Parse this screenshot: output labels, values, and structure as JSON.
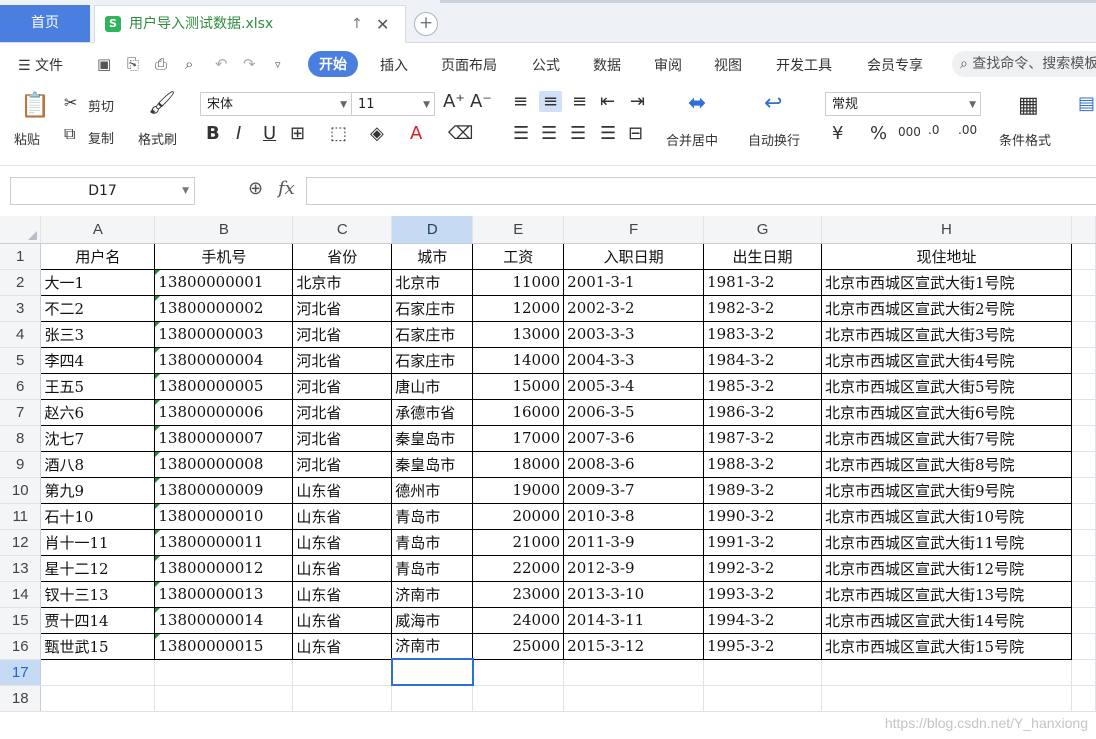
{
  "tabs": {
    "home": "首页",
    "file_name": "用户导入测试数据.xlsx"
  },
  "menu": {
    "file": "文件",
    "tabs": [
      "开始",
      "插入",
      "页面布局",
      "公式",
      "数据",
      "审阅",
      "视图",
      "开发工具",
      "会员专享"
    ],
    "search_placeholder": "查找命令、搜索模板"
  },
  "ribbon": {
    "paste": "粘贴",
    "cut": "剪切",
    "copy": "复制",
    "format_painter": "格式刷",
    "font_name": "宋体",
    "font_size": "11",
    "merge_center": "合并居中",
    "wrap_text": "自动换行",
    "number_format": "常规",
    "conditional_format": "条件格式"
  },
  "formula_bar": {
    "cell_ref": "D17",
    "fx": "fx",
    "value": ""
  },
  "sheet": {
    "columns": [
      "A",
      "B",
      "C",
      "D",
      "E",
      "F",
      "G",
      "H"
    ],
    "headers": [
      "用户名",
      "手机号",
      "省份",
      "城市",
      "工资",
      "入职日期",
      "出生日期",
      "现住地址"
    ],
    "rows": [
      [
        "大一1",
        "13800000001",
        "北京市",
        "北京市",
        "11000",
        "2001-3-1",
        "1981-3-2",
        "北京市西城区宣武大街1号院"
      ],
      [
        "不二2",
        "13800000002",
        "河北省",
        "石家庄市",
        "12000",
        "2002-3-2",
        "1982-3-2",
        "北京市西城区宣武大街2号院"
      ],
      [
        "张三3",
        "13800000003",
        "河北省",
        "石家庄市",
        "13000",
        "2003-3-3",
        "1983-3-2",
        "北京市西城区宣武大街3号院"
      ],
      [
        "李四4",
        "13800000004",
        "河北省",
        "石家庄市",
        "14000",
        "2004-3-3",
        "1984-3-2",
        "北京市西城区宣武大街4号院"
      ],
      [
        "王五5",
        "13800000005",
        "河北省",
        "唐山市",
        "15000",
        "2005-3-4",
        "1985-3-2",
        "北京市西城区宣武大街5号院"
      ],
      [
        "赵六6",
        "13800000006",
        "河北省",
        "承德市省",
        "16000",
        "2006-3-5",
        "1986-3-2",
        "北京市西城区宣武大街6号院"
      ],
      [
        "沈七7",
        "13800000007",
        "河北省",
        "秦皇岛市",
        "17000",
        "2007-3-6",
        "1987-3-2",
        "北京市西城区宣武大街7号院"
      ],
      [
        "酒八8",
        "13800000008",
        "河北省",
        "秦皇岛市",
        "18000",
        "2008-3-6",
        "1988-3-2",
        "北京市西城区宣武大街8号院"
      ],
      [
        "第九9",
        "13800000009",
        "山东省",
        "德州市",
        "19000",
        "2009-3-7",
        "1989-3-2",
        "北京市西城区宣武大街9号院"
      ],
      [
        "石十10",
        "13800000010",
        "山东省",
        "青岛市",
        "20000",
        "2010-3-8",
        "1990-3-2",
        "北京市西城区宣武大街10号院"
      ],
      [
        "肖十一11",
        "13800000011",
        "山东省",
        "青岛市",
        "21000",
        "2011-3-9",
        "1991-3-2",
        "北京市西城区宣武大街11号院"
      ],
      [
        "星十二12",
        "13800000012",
        "山东省",
        "青岛市",
        "22000",
        "2012-3-9",
        "1992-3-2",
        "北京市西城区宣武大街12号院"
      ],
      [
        "钗十三13",
        "13800000013",
        "山东省",
        "济南市",
        "23000",
        "2013-3-10",
        "1993-3-2",
        "北京市西城区宣武大街13号院"
      ],
      [
        "贾十四14",
        "13800000014",
        "山东省",
        "威海市",
        "24000",
        "2014-3-11",
        "1994-3-2",
        "北京市西城区宣武大街14号院"
      ],
      [
        "甄世武15",
        "13800000015",
        "山东省",
        "济南市",
        "25000",
        "2015-3-12",
        "1995-3-2",
        "北京市西城区宣武大街15号院"
      ]
    ],
    "row_numbers": [
      "1",
      "2",
      "3",
      "4",
      "5",
      "6",
      "7",
      "8",
      "9",
      "10",
      "11",
      "12",
      "13",
      "14",
      "15",
      "16",
      "17",
      "18"
    ]
  },
  "watermark": "https://blog.csdn.net/Y_hanxiong"
}
